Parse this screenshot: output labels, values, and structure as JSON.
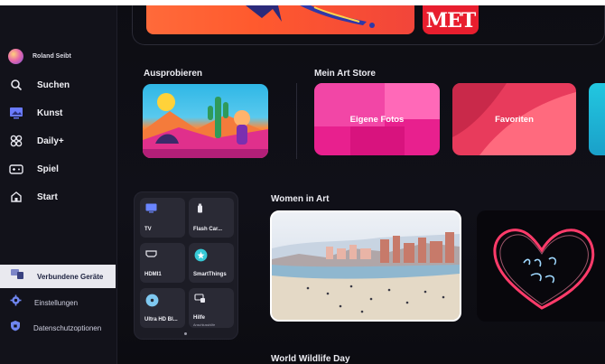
{
  "profile": {
    "name": "Roland Seibt"
  },
  "nav": [
    {
      "label": "Suchen",
      "icon": "search-icon"
    },
    {
      "label": "Kunst",
      "icon": "art-icon"
    },
    {
      "label": "Daily+",
      "icon": "daily-plus-icon"
    },
    {
      "label": "Spiel",
      "icon": "game-icon"
    },
    {
      "label": "Start",
      "icon": "home-icon"
    }
  ],
  "bottom_nav": [
    {
      "label": "Verbundene Geräte",
      "icon": "devices-icon",
      "active": true
    },
    {
      "label": "Einstellungen",
      "icon": "gear-icon"
    },
    {
      "label": "Datenschutzoptionen",
      "icon": "shield-icon"
    }
  ],
  "top_row": {
    "logo_text": "MET"
  },
  "sections": {
    "ausprobieren": "Ausprobieren",
    "art_store": "Mein Art Store",
    "women_in_art": "Women in Art",
    "wildlife": "World Wildlife Day"
  },
  "store_cards": [
    {
      "label": "Eigene Fotos",
      "color": "#e8208e"
    },
    {
      "label": "Favoriten",
      "color": "#e83b5c"
    }
  ],
  "devices": [
    {
      "label": "TV",
      "sub": "",
      "icon": "tv-icon"
    },
    {
      "label": "Flash Car...",
      "sub": "",
      "icon": "usb-icon"
    },
    {
      "label": "HDMI1",
      "sub": "",
      "icon": "hdmi-icon"
    },
    {
      "label": "SmartThings",
      "sub": "",
      "icon": "smartthings-icon"
    },
    {
      "label": "Ultra HD Bl...",
      "sub": "",
      "icon": "bluray-icon"
    },
    {
      "label": "Hilfe",
      "sub": "Anschlusshilfe",
      "icon": "help-icon"
    }
  ],
  "colors": {
    "accent_pink": "#e8208e",
    "accent_red": "#e83b5c",
    "smartthings": "#36c9d6"
  }
}
